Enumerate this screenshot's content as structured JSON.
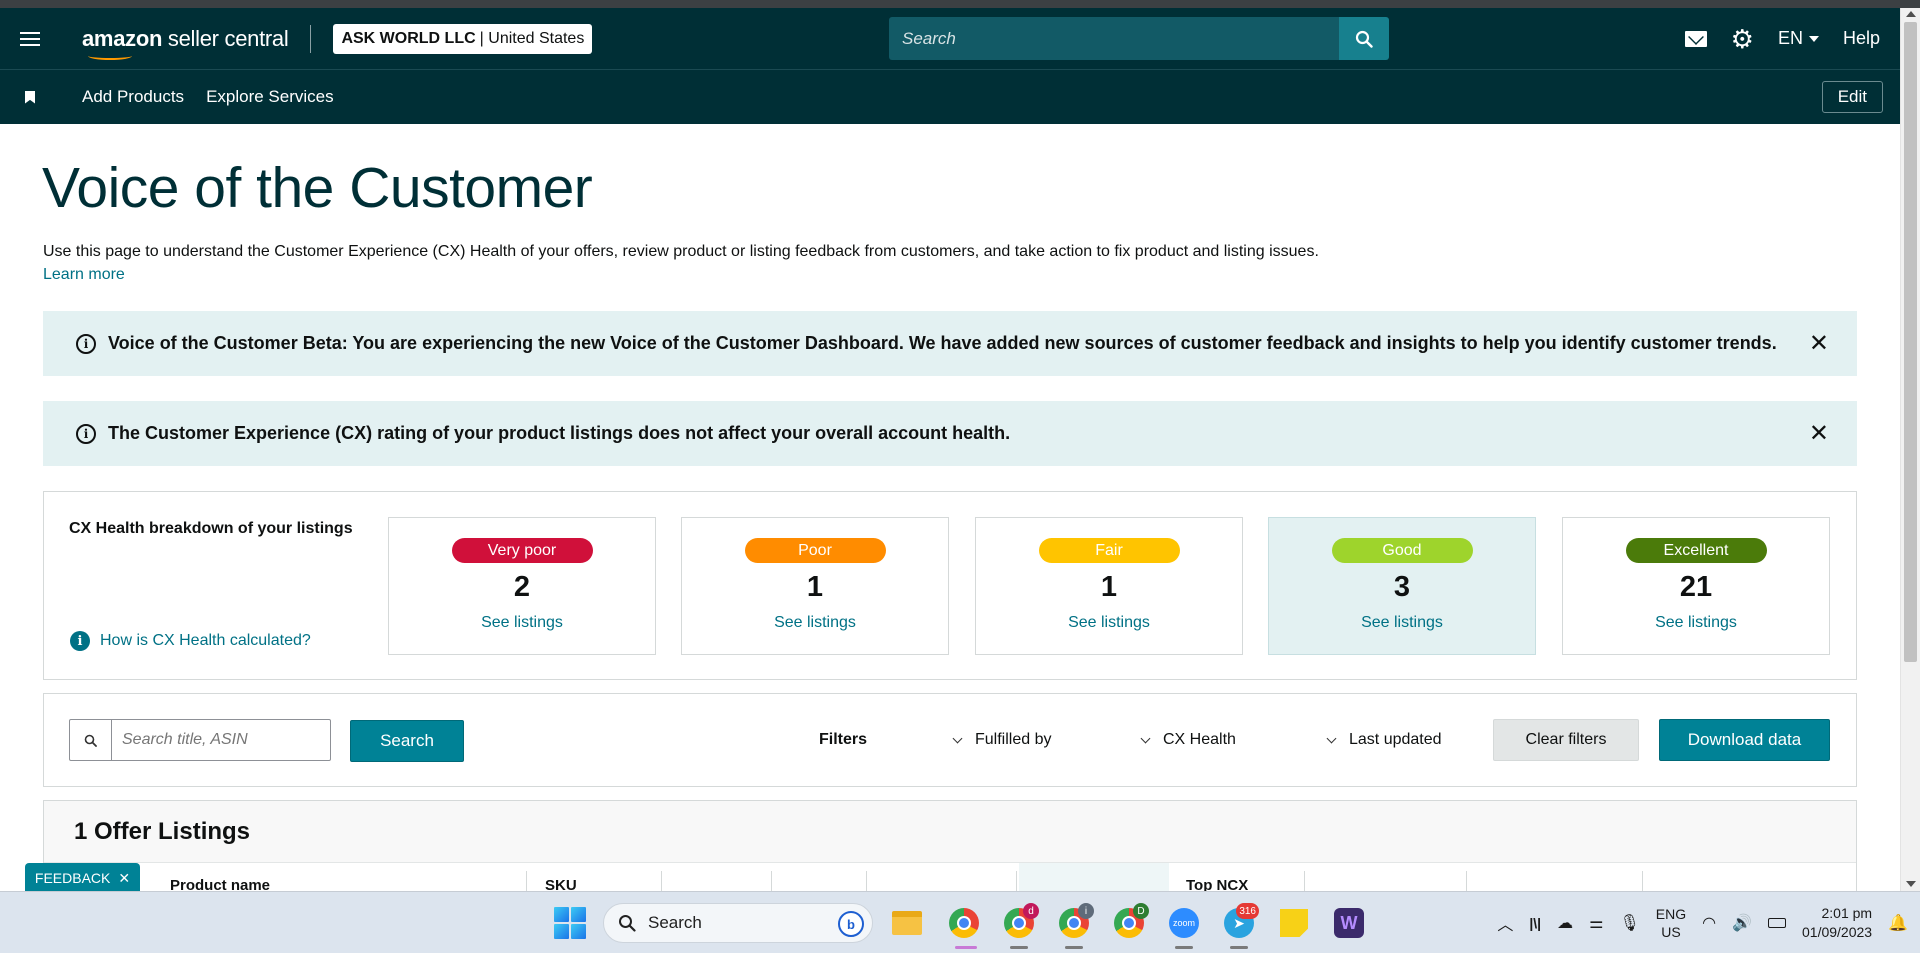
{
  "header": {
    "logo_bold": "amazon",
    "logo_rest": " seller central",
    "account_name": "ASK WORLD LLC",
    "account_region": "United States",
    "search_placeholder": "Search",
    "language": "EN",
    "help": "Help"
  },
  "subnav": {
    "links": [
      "Add Products",
      "Explore Services"
    ],
    "edit": "Edit"
  },
  "page": {
    "title": "Voice of the Customer",
    "description": "Use this page to understand the Customer Experience (CX) Health of your offers, review product or listing feedback from customers, and take action to fix product and listing issues.",
    "learn_more": "Learn more"
  },
  "alerts": [
    {
      "text": "Voice of the Customer Beta: You are experiencing the new Voice of the Customer Dashboard. We have added new sources of customer feedback and insights to help you identify customer trends."
    },
    {
      "text": "The Customer Experience (CX) rating of your product listings does not affect your overall account health."
    }
  ],
  "cx_health": {
    "title": "CX Health breakdown of your listings",
    "how_link": "How is CX Health calculated?",
    "cards": [
      {
        "label": "Very poor",
        "count": "2",
        "link": "See listings",
        "color": "#d0103a"
      },
      {
        "label": "Poor",
        "count": "1",
        "link": "See listings",
        "color": "#ff8c00"
      },
      {
        "label": "Fair",
        "count": "1",
        "link": "See listings",
        "color": "#ffc400"
      },
      {
        "label": "Good",
        "count": "3",
        "link": "See listings",
        "color": "#9ed42c",
        "selected": true
      },
      {
        "label": "Excellent",
        "count": "21",
        "link": "See listings",
        "color": "#4b7b0a"
      }
    ]
  },
  "filters": {
    "search_placeholder": "Search title, ASIN",
    "search_button": "Search",
    "label": "Filters",
    "dropdowns": [
      "Fulfilled by",
      "CX Health",
      "Last updated"
    ],
    "clear": "Clear filters",
    "download": "Download data"
  },
  "listings": {
    "title": "1 Offer Listings",
    "columns": [
      "Product name",
      "SKU",
      "Top NCX"
    ]
  },
  "feedback_tab": "FEEDBACK",
  "taskbar": {
    "search": "Search",
    "badges": {
      "chrome2": "d",
      "chrome3": "i",
      "chrome4": "D",
      "telegram": "316"
    },
    "zoom_label": "zoom",
    "lang_top": "ENG",
    "lang_bottom": "US",
    "time": "2:01 pm",
    "date": "01/09/2023"
  },
  "colors": {
    "nav_bg": "#002f36",
    "link": "#007185",
    "primary_button": "#008296",
    "alert_bg": "#e3f1f2"
  }
}
